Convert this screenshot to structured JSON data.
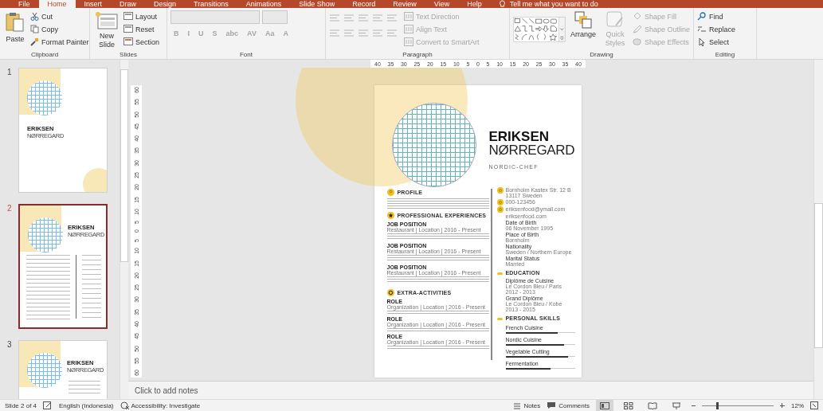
{
  "tabs": [
    {
      "label": "File",
      "selected": false
    },
    {
      "label": "Home",
      "selected": true
    },
    {
      "label": "Insert",
      "selected": false
    },
    {
      "label": "Draw",
      "selected": false
    },
    {
      "label": "Design",
      "selected": false
    },
    {
      "label": "Transitions",
      "selected": false
    },
    {
      "label": "Animations",
      "selected": false
    },
    {
      "label": "Slide Show",
      "selected": false
    },
    {
      "label": "Record",
      "selected": false
    },
    {
      "label": "Review",
      "selected": false
    },
    {
      "label": "View",
      "selected": false
    },
    {
      "label": "Help",
      "selected": false
    }
  ],
  "tell_me": "Tell me what you want to do",
  "ribbon": {
    "clipboard": {
      "label": "Clipboard",
      "paste": "Paste",
      "items": [
        {
          "kind": "cut",
          "label": "Cut"
        },
        {
          "kind": "copy",
          "label": "Copy"
        },
        {
          "kind": "painter",
          "label": "Format Painter"
        }
      ]
    },
    "slides": {
      "label": "Slides",
      "new_slide": "New Slide",
      "items": [
        {
          "kind": "layout",
          "label": "Layout"
        },
        {
          "kind": "reset",
          "label": "Reset"
        },
        {
          "kind": "section",
          "label": "Section"
        }
      ]
    },
    "font": {
      "label": "Font",
      "disabled": true,
      "buttons": [
        "B",
        "I",
        "U",
        "S",
        "abc",
        "AV",
        "Aa",
        "A"
      ]
    },
    "paragraph": {
      "label": "Paragraph",
      "items": [
        {
          "label": "Text Direction",
          "disabled": true
        },
        {
          "label": "Align Text",
          "disabled": true
        },
        {
          "label": "Convert to SmartArt",
          "disabled": true
        }
      ]
    },
    "drawing": {
      "label": "Drawing",
      "arrange": "Arrange",
      "quick_styles": {
        "label": "Quick Styles",
        "disabled": true
      },
      "items": [
        {
          "kind": "fill",
          "label": "Shape Fill",
          "disabled": true
        },
        {
          "kind": "outline",
          "label": "Shape Outline",
          "disabled": true
        },
        {
          "kind": "effects",
          "label": "Shape Effects",
          "disabled": true
        }
      ]
    },
    "editing": {
      "label": "Editing",
      "items": [
        {
          "kind": "find",
          "label": "Find"
        },
        {
          "kind": "replace",
          "label": "Replace"
        },
        {
          "kind": "select",
          "label": "Select"
        }
      ]
    }
  },
  "thumbnails": [
    {
      "number": "1",
      "kind": "cover",
      "selected": false,
      "first_name": "ERIKSEN",
      "last_name": "NØRREGARD"
    },
    {
      "number": "2",
      "kind": "resume",
      "selected": true,
      "first_name": "ERIKSEN",
      "last_name": "NØRREGARD"
    },
    {
      "number": "3",
      "kind": "letter",
      "selected": false,
      "first_name": "ERIKSEN",
      "last_name": "NØRREGARD"
    }
  ],
  "ruler_h": [
    "40",
    "35",
    "30",
    "25",
    "20",
    "15",
    "10",
    "5",
    "0",
    "5",
    "10",
    "15",
    "20",
    "25",
    "30",
    "35",
    "40"
  ],
  "ruler_v": [
    "60",
    "55",
    "50",
    "45",
    "40",
    "35",
    "30",
    "25",
    "20",
    "15",
    "10",
    "5",
    "0",
    "5",
    "10",
    "15",
    "20",
    "25",
    "30",
    "35",
    "40",
    "45",
    "50",
    "55",
    "60"
  ],
  "slide": {
    "first_name": "ERIKSEN",
    "last_name": "NØRREGARD",
    "subtitle": "NORDIC-CHEF",
    "sections": [
      {
        "kind": "profile",
        "title": "PROFILE"
      },
      {
        "kind": "experience",
        "title": "PROFESSIONAL EXPERIENCES",
        "entries": [
          {
            "title": "JOB POSITION",
            "meta": "Restaurant | Location | 2016 - Present"
          },
          {
            "title": "JOB POSITION",
            "meta": "Restaurant | Location | 2016 - Present"
          },
          {
            "title": "JOB POSITION",
            "meta": "Restaurant | Location | 2016 - Present"
          }
        ]
      },
      {
        "kind": "activities",
        "title": "EXTRA-ACTIVITIES",
        "entries": [
          {
            "title": "ROLE",
            "meta": "Organization | Location | 2016 - Present"
          },
          {
            "title": "ROLE",
            "meta": "Organization | Location | 2016 - Present"
          },
          {
            "title": "ROLE",
            "meta": "Organization | Location | 2016 - Present"
          }
        ]
      }
    ],
    "contacts": [
      {
        "kind": "address",
        "lines": [
          "Bornholm Kastex Str. 12 B",
          "13117 Sweden"
        ]
      },
      {
        "kind": "phone",
        "lines": [
          "000-123456"
        ]
      },
      {
        "kind": "email",
        "lines": [
          "eriksenfood@ymail.com"
        ]
      },
      {
        "kind": "web",
        "lines": [
          "eriksenfood.com"
        ]
      }
    ],
    "details": [
      {
        "label": "Date of Birth",
        "value": "06 November 1995"
      },
      {
        "label": "Place of Birth",
        "value": "Bornholm"
      },
      {
        "label": "Nationality",
        "value": "Sweden / Northern Europe"
      },
      {
        "label": "Marital Status",
        "value": "Married"
      }
    ],
    "education": {
      "title": "EDUCATION",
      "items": [
        {
          "degree": "Diplôme de Cuisine",
          "school": "Le Cordon Bleu / Paris",
          "years": "2012 - 2013"
        },
        {
          "degree": "Grand Diplôme",
          "school": "Le Cordon Bleu / Kobe",
          "years": "2013 - 2015"
        }
      ]
    },
    "skills": {
      "title": "PERSONAL SKILLS",
      "items": [
        {
          "name": "French Cuisine",
          "level": 0.75
        },
        {
          "name": "Nordic Cuisine",
          "level": 0.85
        },
        {
          "name": "Vegetable Cutting",
          "level": 0.9
        },
        {
          "name": "Fermentation",
          "level": 0.65
        }
      ]
    }
  },
  "notes_placeholder": "Click to add notes",
  "status": {
    "slide": "Slide 2 of 4",
    "language": "English (Indonesia)",
    "accessibility": "Accessibility: Investigate",
    "notes": "Notes",
    "comments": "Comments",
    "views": [
      {
        "kind": "normal",
        "selected": true
      },
      {
        "kind": "sorter",
        "selected": false
      },
      {
        "kind": "reading",
        "selected": false
      },
      {
        "kind": "show",
        "selected": false
      }
    ],
    "zoom": {
      "level": 0.2,
      "label": "12%"
    }
  }
}
